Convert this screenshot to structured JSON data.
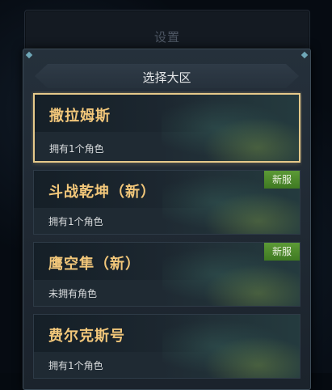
{
  "background_panel": {
    "title": "设置"
  },
  "dialog": {
    "title": "选择大区"
  },
  "servers": [
    {
      "name": "撒拉姆斯",
      "status": "拥有1个角色",
      "tag": "",
      "selected": true
    },
    {
      "name": "斗战乾坤（新）",
      "status": "拥有1个角色",
      "tag": "新服",
      "selected": false
    },
    {
      "name": "鹰空隼（新）",
      "status": "未拥有角色",
      "tag": "新服",
      "selected": false
    },
    {
      "name": "费尔克斯号",
      "status": "拥有1个角色",
      "tag": "",
      "selected": false
    }
  ],
  "colors": {
    "accent_gold": "#f2c77a",
    "selected_border": "#e6c98a",
    "new_tag": "#4f8a2c"
  }
}
